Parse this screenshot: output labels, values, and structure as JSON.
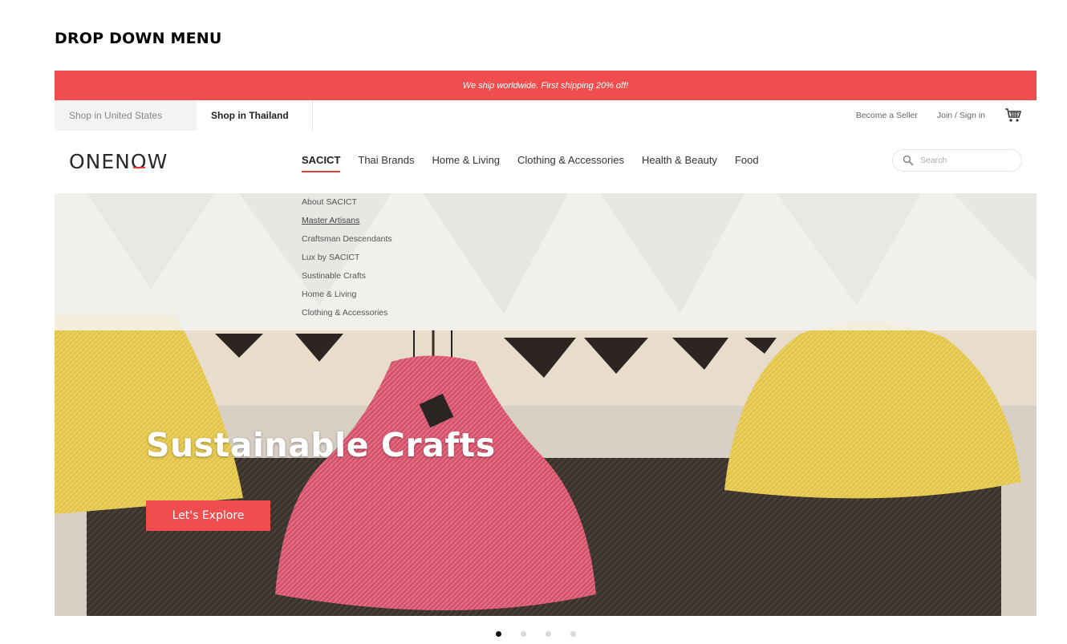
{
  "doc_heading": "DROP DOWN MENU",
  "promo": {
    "text": "We ship worldwide. First shipping 20% off!"
  },
  "shop_bar": {
    "tabs": [
      {
        "label": "Shop in United States",
        "active": false
      },
      {
        "label": "Shop in Thailand",
        "active": true
      }
    ],
    "become_seller": "Become a Seller",
    "join_signin": "Join / Sign in",
    "cart_icon": "cart-icon"
  },
  "nav": {
    "logo": {
      "pre": "ONEN",
      "accent": "O",
      "post": "W"
    },
    "items": [
      {
        "label": "SACICT",
        "active": true
      },
      {
        "label": "Thai Brands"
      },
      {
        "label": "Home & Living"
      },
      {
        "label": "Clothing & Accessories"
      },
      {
        "label": "Health & Beauty"
      },
      {
        "label": "Food"
      }
    ],
    "search": {
      "placeholder": "Search",
      "icon": "search-icon"
    }
  },
  "dropdown": {
    "items": [
      {
        "label": "About SACICT"
      },
      {
        "label": "Master Artisans",
        "hover": true
      },
      {
        "label": "Craftsman Descendants"
      },
      {
        "label": "Lux by SACICT"
      },
      {
        "label": "Sustinable Crafts"
      },
      {
        "label": "Home & Living"
      },
      {
        "label": "Clothing & Accessories"
      }
    ]
  },
  "hero": {
    "title": "Sustainable Crafts",
    "cta": "Let's Explore",
    "colors": {
      "accent": "#f04e4e",
      "lamp_yellow": "#e3c648",
      "lamp_pink": "#d7536c"
    }
  },
  "carousel": {
    "slides": 4,
    "active": 1
  }
}
